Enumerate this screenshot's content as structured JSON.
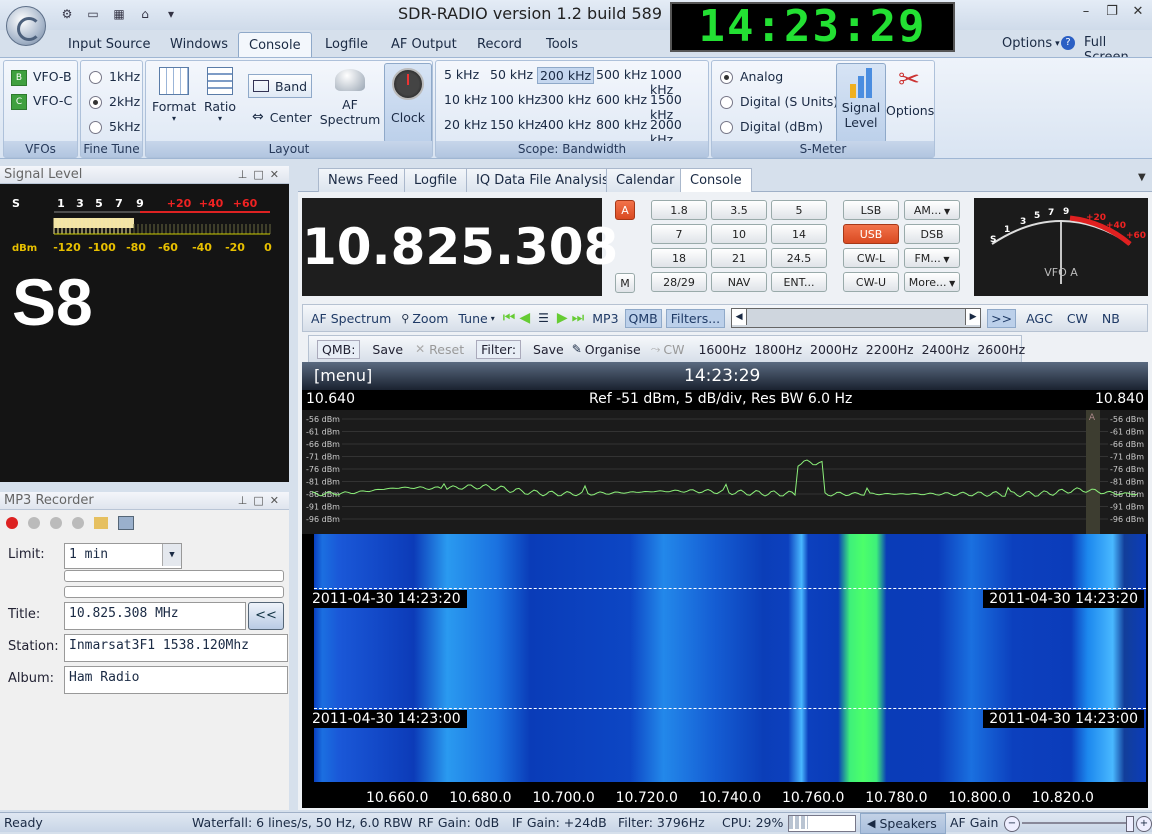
{
  "title": "SDR-RADIO version 1.2  build 589",
  "clock": "14:23:29",
  "window_buttons": [
    "–",
    "❐",
    "✕"
  ],
  "menu": {
    "tabs": [
      "Input Source",
      "Windows",
      "Console",
      "Logfile",
      "AF Output",
      "Record",
      "Tools"
    ],
    "options": "Options",
    "full_screen": "Full Screen"
  },
  "ribbon": {
    "vfos": {
      "label": "VFOs",
      "items": [
        {
          "badge": "B",
          "name": "VFO-B"
        },
        {
          "badge": "C",
          "name": "VFO-C"
        }
      ]
    },
    "fine_tune": {
      "label": "Fine Tune",
      "options": [
        "1kHz",
        "2kHz",
        "5kHz"
      ],
      "selected": "2kHz"
    },
    "layout": {
      "label": "Layout",
      "format": "Format",
      "ratio": "Ratio",
      "band": "Band",
      "center": "Center",
      "af_spectrum_1": "AF",
      "af_spectrum_2": "Spectrum",
      "clock": "Clock"
    },
    "scope": {
      "label": "Scope: Bandwidth",
      "grid": [
        [
          "5 kHz",
          "50 kHz",
          "200 kHz",
          "500 kHz",
          "1000 kHz"
        ],
        [
          "10 kHz",
          "100 kHz",
          "300 kHz",
          "600 kHz",
          "1500 kHz"
        ],
        [
          "20 kHz",
          "150 kHz",
          "400 kHz",
          "800 kHz",
          "2000 kHz"
        ]
      ],
      "selected": "200 kHz"
    },
    "smeter": {
      "label": "S-Meter",
      "options": [
        "Analog",
        "Digital (S Units)",
        "Digital (dBm)"
      ],
      "selected": "Analog",
      "signal_level_1": "Signal",
      "signal_level_2": "Level",
      "options_btn": "Options"
    }
  },
  "signal_pane": {
    "title": "Signal Level",
    "s_label": "S",
    "s_ticks": [
      "1",
      "3",
      "5",
      "7",
      "9"
    ],
    "plus_ticks": [
      "+20",
      "+40",
      "+60"
    ],
    "dbm_label": "dBm",
    "dbm_ticks": [
      "-120",
      "-100",
      "-80",
      "-60",
      "-40",
      "-20",
      "0"
    ],
    "reading": "S8"
  },
  "mp3_pane": {
    "title": "MP3 Recorder",
    "limit_label": "Limit:",
    "limit_value": "1 min",
    "title_label": "Title:",
    "title_value": "10.825.308 MHz",
    "station_label": "Station:",
    "station_value": "Inmarsat3F1 1538.120Mhz",
    "album_label": "Album:",
    "album_value": "Ham Radio",
    "copy_btn": "<<"
  },
  "doc_tabs": [
    "News Feed",
    "Logfile",
    "IQ Data File Analysis",
    "Calendar",
    "Console"
  ],
  "doc_active": "Console",
  "console": {
    "frequency": "10.825.308",
    "a_btn": "A",
    "m_btn": "M",
    "band_keys": [
      [
        "1.8",
        "3.5",
        "5"
      ],
      [
        "7",
        "10",
        "14"
      ],
      [
        "18",
        "21",
        "24.5"
      ],
      [
        "28/29",
        "NAV",
        "ENT..."
      ]
    ],
    "mode_keys": [
      [
        "LSB",
        "AM..."
      ],
      [
        "USB",
        "DSB"
      ],
      [
        "CW-L",
        "FM..."
      ],
      [
        "CW-U",
        "More..."
      ]
    ],
    "selected_mode": "USB",
    "smeter_label": "VFO A",
    "smeter_ticks": [
      "S",
      "1",
      "3",
      "5",
      "7",
      "9"
    ],
    "smeter_plus": [
      "+20",
      "+40",
      "+60"
    ]
  },
  "toolbar1": {
    "af_spectrum": "AF Spectrum",
    "zoom": "Zoom",
    "tune": "Tune",
    "mp3": "MP3",
    "qmb": "QMB",
    "filters": "Filters...",
    "more": ">>",
    "agc": "AGC",
    "cw": "CW",
    "nb": "NB"
  },
  "toolbar2": {
    "qmb_label": "QMB:",
    "save": "Save",
    "reset": "Reset",
    "filter_label": "Filter:",
    "save2": "Save",
    "organise": "Organise",
    "cw": "CW",
    "presets": [
      "1600Hz",
      "1800Hz",
      "2000Hz",
      "2200Hz",
      "2400Hz",
      "2600Hz"
    ]
  },
  "spectrum": {
    "menu": "[menu]",
    "time": "14:23:29",
    "left_freq": "10.640",
    "right_freq": "10.840",
    "ref": "Ref -51 dBm,  5 dB/div,  Res BW 6.0 Hz",
    "db_ticks": [
      "-56 dBm",
      "-61 dBm",
      "-66 dBm",
      "-71 dBm",
      "-76 dBm",
      "-81 dBm",
      "-86 dBm",
      "-91 dBm",
      "-96 dBm"
    ],
    "marker": "A",
    "timestamps": [
      "2011-04-30  14:23:20",
      "2011-04-30  14:23:00"
    ],
    "x_ticks": [
      "10.660.0",
      "10.680.0",
      "10.700.0",
      "10.720.0",
      "10.740.0",
      "10.760.0",
      "10.780.0",
      "10.800.0",
      "10.820.0"
    ],
    "x_tick_values": [
      10.66,
      10.68,
      10.7,
      10.72,
      10.74,
      10.76,
      10.78,
      10.8,
      10.82
    ],
    "x_range": [
      10.64,
      10.84
    ],
    "trace_color": "#8cf07a"
  },
  "status": {
    "ready": "Ready",
    "waterfall": "Waterfall: 6 lines/s, 50 Hz, 6.0 RBW",
    "rf_gain": "RF Gain: 0dB",
    "if_gain": "IF Gain: +24dB",
    "filter": "Filter: 3796Hz",
    "cpu": "CPU: 29%",
    "cpu_level": 0.29,
    "speakers": "Speakers",
    "af_gain": "AF Gain"
  }
}
